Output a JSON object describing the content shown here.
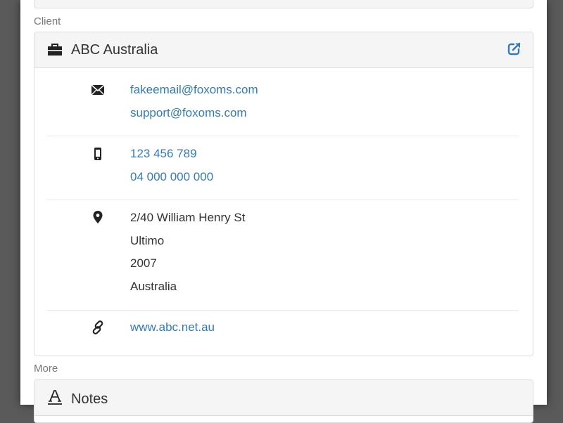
{
  "sections": {
    "client_label": "Client",
    "more_label": "More"
  },
  "client": {
    "name": "ABC Australia",
    "heading_icon": "briefcase-icon",
    "open_icon": "external-link-icon",
    "emails": [
      "fakeemail@foxoms.com",
      "support@foxoms.com"
    ],
    "phones": [
      "123 456 789",
      "04 000 000 000"
    ],
    "address": [
      "2/40 William Henry St",
      "Ultimo",
      "2007",
      "Australia"
    ],
    "website": "www.abc.net.au"
  },
  "notes": {
    "title": "Notes",
    "heading_icon": "font-icon"
  },
  "colors": {
    "link": "#337ab7",
    "text": "#333333",
    "muted": "#777777",
    "panel_heading_bg": "#f5f5f5",
    "border": "#dddddd"
  }
}
